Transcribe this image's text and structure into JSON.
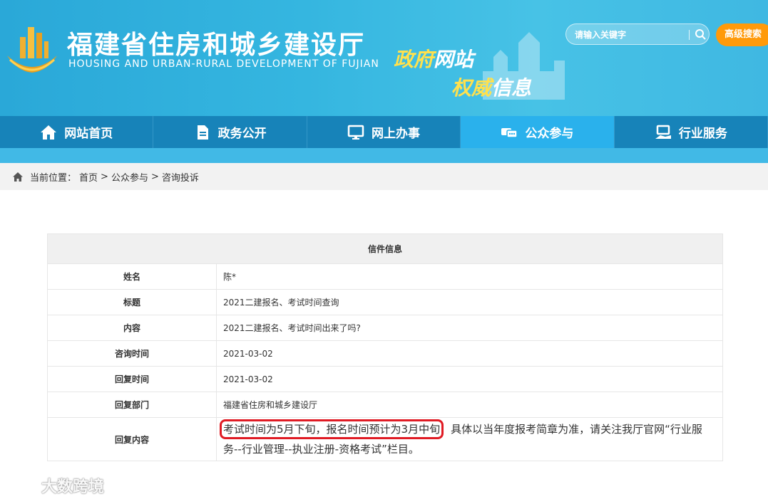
{
  "header": {
    "title": "福建省住房和城乡建设厅",
    "subtitle": "HOUSING AND URBAN-RURAL DEVELOPMENT OF FUJIAN",
    "slogan1_a": "政府",
    "slogan1_b": "网站",
    "slogan2_a": "权威",
    "slogan2_b": "信息",
    "search_placeholder": "请输入关键字",
    "advanced_search": "高级搜索"
  },
  "nav": {
    "items": [
      {
        "label": "网站首页",
        "icon": "home-icon"
      },
      {
        "label": "政务公开",
        "icon": "document-icon"
      },
      {
        "label": "网上办事",
        "icon": "monitor-icon"
      },
      {
        "label": "公众参与",
        "icon": "chat-icon",
        "active": true
      },
      {
        "label": "行业服务",
        "icon": "service-icon"
      }
    ]
  },
  "breadcrumb": {
    "prefix": "当前位置：",
    "home": "首页",
    "sep": ">",
    "level1": "公众参与",
    "level2": "咨询投诉"
  },
  "letter": {
    "heading": "信件信息",
    "rows": [
      {
        "label": "姓名",
        "value": "陈*"
      },
      {
        "label": "标题",
        "value": "2021二建报名、考试时间查询"
      },
      {
        "label": "内容",
        "value": "2021二建报名、考试时间出来了吗?"
      },
      {
        "label": "咨询时间",
        "value": "2021-03-02"
      },
      {
        "label": "回复时间",
        "value": "2021-03-02"
      },
      {
        "label": "回复部门",
        "value": "福建省住房和城乡建设厅"
      }
    ],
    "reply_label": "回复内容",
    "reply_highlight": "考试时间为5月下旬，报名时间预计为3月中旬",
    "reply_rest": "，具体以当年度报考简章为准，请关注我厅官网“行业服务--行业管理--执业注册-资格考试”栏目。"
  },
  "watermark": {
    "text": "大数跨境"
  },
  "colors": {
    "header_bg": "#35b6e0",
    "nav_bg": "#1783b9",
    "nav_active": "#2ab1ec",
    "accent_orange": "#ff9a0a",
    "highlight_red": "#e01b24"
  }
}
